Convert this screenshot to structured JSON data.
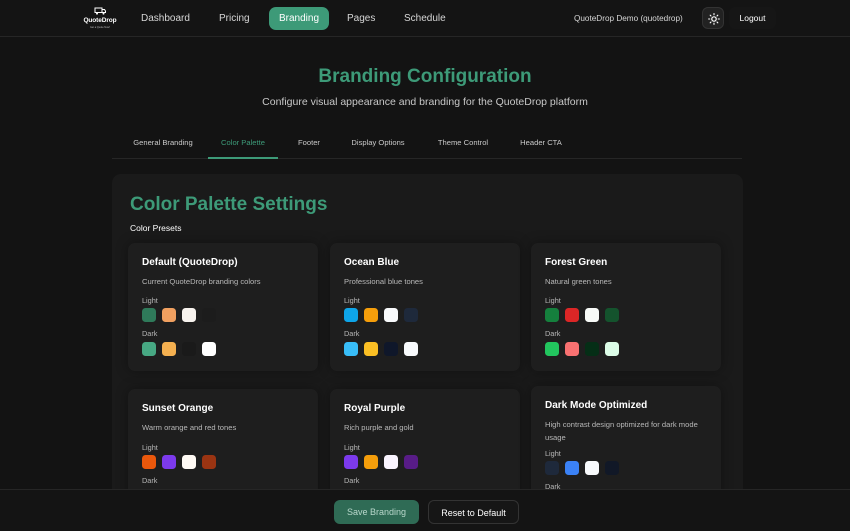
{
  "nav": {
    "logo": {
      "brand": "QuoteDrop",
      "tagline": "Get a Quote Now!",
      "icon": "delivery-truck-icon"
    },
    "links": [
      {
        "label": "Dashboard",
        "active": false
      },
      {
        "label": "Pricing",
        "active": false
      },
      {
        "label": "Branding",
        "active": true
      },
      {
        "label": "Pages",
        "active": false
      },
      {
        "label": "Schedule",
        "active": false
      }
    ],
    "user": "QuoteDrop Demo (quotedrop)",
    "theme_toggle_icon": "sun-icon",
    "logout_label": "Logout"
  },
  "header": {
    "title": "Branding Configuration",
    "subtitle": "Configure visual appearance and branding for the QuoteDrop platform"
  },
  "tabs": [
    {
      "label": "General Branding",
      "active": false
    },
    {
      "label": "Color Palette",
      "active": true
    },
    {
      "label": "Footer",
      "active": false
    },
    {
      "label": "Display Options",
      "active": false
    },
    {
      "label": "Theme Control",
      "active": false
    },
    {
      "label": "Header CTA",
      "active": false
    }
  ],
  "palette": {
    "title": "Color Palette Settings",
    "presets_label": "Color Presets",
    "light_label": "Light",
    "dark_label": "Dark",
    "presets": [
      {
        "name": "Default (QuoteDrop)",
        "description": "Current QuoteDrop branding colors",
        "light": [
          "#2f7a5a",
          "#f0a060",
          "#f7f3ee",
          "#1c1c1c"
        ],
        "dark": [
          "#47a883",
          "#f4b050",
          "#1a1a1a",
          "#ffffff"
        ]
      },
      {
        "name": "Ocean Blue",
        "description": "Professional blue tones",
        "light": [
          "#0ea5e9",
          "#f59e0b",
          "#f8fafc",
          "#1e293b"
        ],
        "dark": [
          "#38bdf8",
          "#fbbf24",
          "#0f172a",
          "#f8fafc"
        ]
      },
      {
        "name": "Forest Green",
        "description": "Natural green tones",
        "light": [
          "#15803d",
          "#dc2626",
          "#f7faf7",
          "#14532d"
        ],
        "dark": [
          "#22c55e",
          "#f87171",
          "#052e16",
          "#dcfce7"
        ]
      },
      {
        "name": "Sunset Orange",
        "description": "Warm orange and red tones",
        "light": [
          "#ea580c",
          "#7c3aed",
          "#fffaf5",
          "#9a3412"
        ],
        "dark": [
          "#fb923c",
          "#a78bfa",
          "#1c1917",
          "#fff7ed"
        ]
      },
      {
        "name": "Royal Purple",
        "description": "Rich purple and gold",
        "light": [
          "#7c3aed",
          "#f59e0b",
          "#faf5ff",
          "#581c87"
        ],
        "dark": [
          "#a78bfa",
          "#fbbf24",
          "#1e1b4b",
          "#faf5ff"
        ]
      },
      {
        "name": "Dark Mode Optimized",
        "description": "High contrast design optimized for dark mode usage",
        "light": [
          "#1e293b",
          "#3b82f6",
          "#f8fafc",
          "#111827"
        ],
        "dark": [
          "#60a5fa",
          "#93c5fd",
          "#0f172a",
          "#f1f5f9"
        ]
      }
    ]
  },
  "footer": {
    "save_label": "Save Branding",
    "reset_label": "Reset to Default"
  },
  "colors": {
    "accent": "#3d9a78",
    "background": "#131313",
    "card": "#1a1a1a",
    "preset_card": "#1e1e1e"
  }
}
